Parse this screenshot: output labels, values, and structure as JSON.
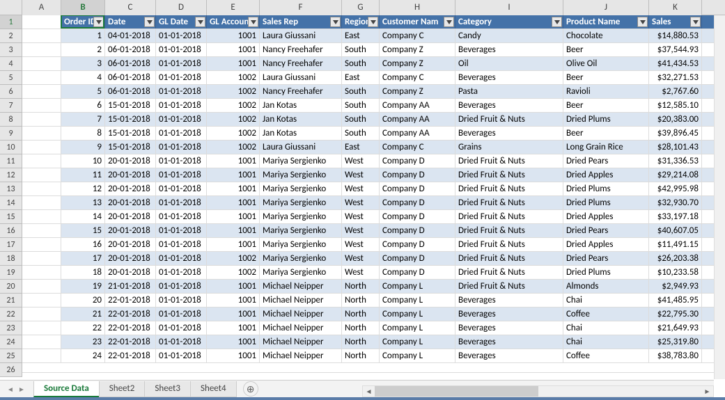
{
  "columns": [
    {
      "letter": "A",
      "width": 56
    },
    {
      "letter": "B",
      "width": 63,
      "selected": true
    },
    {
      "letter": "C",
      "width": 73
    },
    {
      "letter": "D",
      "width": 73
    },
    {
      "letter": "E",
      "width": 76
    },
    {
      "letter": "F",
      "width": 118
    },
    {
      "letter": "G",
      "width": 54
    },
    {
      "letter": "H",
      "width": 109
    },
    {
      "letter": "I",
      "width": 155
    },
    {
      "letter": "J",
      "width": 123
    },
    {
      "letter": "K",
      "width": 76
    }
  ],
  "headers": [
    "Order ID",
    "Date",
    "GL Date",
    "GL Accoun",
    "Sales Rep",
    "Region",
    "Customer Nam",
    "Category",
    "Product Name",
    "Sales"
  ],
  "rows": [
    {
      "n": 2,
      "d": [
        "1",
        "04-01-2018",
        "01-01-2018",
        "1001",
        "Laura Giussani",
        "East",
        "Company C",
        "Candy",
        "Chocolate",
        "$14,880.53"
      ]
    },
    {
      "n": 3,
      "d": [
        "2",
        "06-01-2018",
        "01-01-2018",
        "1001",
        "Nancy Freehafer",
        "South",
        "Company Z",
        "Beverages",
        "Beer",
        "$37,544.93"
      ]
    },
    {
      "n": 4,
      "d": [
        "3",
        "06-01-2018",
        "01-01-2018",
        "1001",
        "Nancy Freehafer",
        "South",
        "Company Z",
        "Oil",
        "Olive Oil",
        "$41,434.53"
      ]
    },
    {
      "n": 5,
      "d": [
        "4",
        "06-01-2018",
        "01-01-2018",
        "1002",
        "Laura Giussani",
        "East",
        "Company C",
        "Beverages",
        "Beer",
        "$32,271.53"
      ]
    },
    {
      "n": 6,
      "d": [
        "5",
        "06-01-2018",
        "01-01-2018",
        "1002",
        "Nancy Freehafer",
        "South",
        "Company Z",
        "Pasta",
        "Ravioli",
        "$2,767.60"
      ]
    },
    {
      "n": 7,
      "d": [
        "6",
        "15-01-2018",
        "01-01-2018",
        "1002",
        "Jan Kotas",
        "South",
        "Company AA",
        "Beverages",
        "Beer",
        "$12,585.10"
      ]
    },
    {
      "n": 8,
      "d": [
        "7",
        "15-01-2018",
        "01-01-2018",
        "1002",
        "Jan Kotas",
        "South",
        "Company AA",
        "Dried Fruit & Nuts",
        "Dried Plums",
        "$20,383.00"
      ]
    },
    {
      "n": 9,
      "d": [
        "8",
        "15-01-2018",
        "01-01-2018",
        "1002",
        "Jan Kotas",
        "South",
        "Company AA",
        "Beverages",
        "Beer",
        "$39,896.45"
      ]
    },
    {
      "n": 10,
      "d": [
        "9",
        "15-01-2018",
        "01-01-2018",
        "1002",
        "Laura Giussani",
        "East",
        "Company C",
        "Grains",
        "Long Grain Rice",
        "$28,101.43"
      ]
    },
    {
      "n": 11,
      "d": [
        "10",
        "20-01-2018",
        "01-01-2018",
        "1001",
        "Mariya Sergienko",
        "West",
        "Company D",
        "Dried Fruit & Nuts",
        "Dried Pears",
        "$31,336.53"
      ]
    },
    {
      "n": 12,
      "d": [
        "11",
        "20-01-2018",
        "01-01-2018",
        "1001",
        "Mariya Sergienko",
        "West",
        "Company D",
        "Dried Fruit & Nuts",
        "Dried Apples",
        "$29,214.08"
      ]
    },
    {
      "n": 13,
      "d": [
        "12",
        "20-01-2018",
        "01-01-2018",
        "1001",
        "Mariya Sergienko",
        "West",
        "Company D",
        "Dried Fruit & Nuts",
        "Dried Plums",
        "$42,995.98"
      ]
    },
    {
      "n": 14,
      "d": [
        "13",
        "20-01-2018",
        "01-01-2018",
        "1001",
        "Mariya Sergienko",
        "West",
        "Company D",
        "Dried Fruit & Nuts",
        "Dried Plums",
        "$32,930.70"
      ]
    },
    {
      "n": 15,
      "d": [
        "14",
        "20-01-2018",
        "01-01-2018",
        "1001",
        "Mariya Sergienko",
        "West",
        "Company D",
        "Dried Fruit & Nuts",
        "Dried Apples",
        "$33,197.18"
      ]
    },
    {
      "n": 16,
      "d": [
        "15",
        "20-01-2018",
        "01-01-2018",
        "1001",
        "Mariya Sergienko",
        "West",
        "Company D",
        "Dried Fruit & Nuts",
        "Dried Pears",
        "$40,607.05"
      ]
    },
    {
      "n": 17,
      "d": [
        "16",
        "20-01-2018",
        "01-01-2018",
        "1001",
        "Mariya Sergienko",
        "West",
        "Company D",
        "Dried Fruit & Nuts",
        "Dried Apples",
        "$11,491.15"
      ]
    },
    {
      "n": 18,
      "d": [
        "17",
        "20-01-2018",
        "01-01-2018",
        "1002",
        "Mariya Sergienko",
        "West",
        "Company D",
        "Dried Fruit & Nuts",
        "Dried Pears",
        "$26,203.38"
      ]
    },
    {
      "n": 19,
      "d": [
        "18",
        "20-01-2018",
        "01-01-2018",
        "1002",
        "Mariya Sergienko",
        "West",
        "Company D",
        "Dried Fruit & Nuts",
        "Dried Plums",
        "$10,233.58"
      ]
    },
    {
      "n": 20,
      "d": [
        "19",
        "21-01-2018",
        "01-01-2018",
        "1001",
        "Michael Neipper",
        "North",
        "Company L",
        "Dried Fruit & Nuts",
        "Almonds",
        "$2,949.93"
      ]
    },
    {
      "n": 21,
      "d": [
        "20",
        "22-01-2018",
        "01-01-2018",
        "1001",
        "Michael Neipper",
        "North",
        "Company L",
        "Beverages",
        "Chai",
        "$41,485.95"
      ]
    },
    {
      "n": 22,
      "d": [
        "21",
        "22-01-2018",
        "01-01-2018",
        "1001",
        "Michael Neipper",
        "North",
        "Company L",
        "Beverages",
        "Coffee",
        "$22,795.30"
      ]
    },
    {
      "n": 23,
      "d": [
        "22",
        "22-01-2018",
        "01-01-2018",
        "1001",
        "Michael Neipper",
        "North",
        "Company L",
        "Beverages",
        "Chai",
        "$21,649.93"
      ]
    },
    {
      "n": 24,
      "d": [
        "23",
        "22-01-2018",
        "01-01-2018",
        "1001",
        "Michael Neipper",
        "North",
        "Company L",
        "Beverages",
        "Chai",
        "$25,319.80"
      ]
    },
    {
      "n": 25,
      "d": [
        "24",
        "22-01-2018",
        "01-01-2018",
        "1001",
        "Michael Neipper",
        "North",
        "Company L",
        "Beverages",
        "Coffee",
        "$38,783.80"
      ]
    }
  ],
  "sheets": [
    {
      "name": "Source Data",
      "active": true
    },
    {
      "name": "Sheet2",
      "active": false
    },
    {
      "name": "Sheet3",
      "active": false
    },
    {
      "name": "Sheet4",
      "active": false
    }
  ],
  "selection": {
    "row": 1,
    "col": "B"
  }
}
